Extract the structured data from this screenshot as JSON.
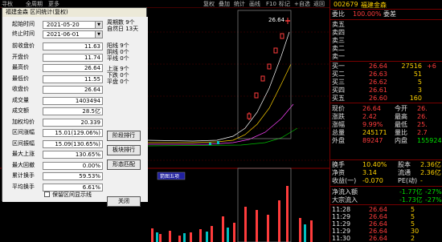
{
  "toolbar": {
    "items": [
      "寻秋",
      "全周期",
      "更多"
    ],
    "right_items": [
      "复权",
      "叠加",
      "统计",
      "画线",
      "F10",
      "标记",
      "+自选",
      "返回"
    ]
  },
  "chart": {
    "price_label": "26.64"
  },
  "dialog": {
    "title": "福建金森 区间统计(复权)",
    "start_label": "起始时间",
    "start_value": "2021-05-20",
    "end_label": "终止时间",
    "end_value": "2021-06-01",
    "cycle_info": "周期数 9个\n自然日 13天",
    "rows": [
      {
        "label": "前收盘价",
        "value": "11.63"
      },
      {
        "label": "开盘价",
        "value": "11.74"
      },
      {
        "label": "最高价",
        "value": "26.64"
      },
      {
        "label": "最低价",
        "value": "11.55"
      },
      {
        "label": "收盘价",
        "value": "26.64"
      },
      {
        "label": "成交量",
        "value": "1403494"
      },
      {
        "label": "成交额",
        "value": "28.5亿"
      },
      {
        "label": "加权均价",
        "value": "20.339"
      },
      {
        "label": "区间涨幅",
        "value": "15.01(129.06%)"
      },
      {
        "label": "区间振幅",
        "value": "15.09(130.65%)"
      },
      {
        "label": "最大上涨",
        "value": "130.65%"
      },
      {
        "label": "最大回撤",
        "value": "0.00%"
      },
      {
        "label": "累计换手",
        "value": "59.53%"
      },
      {
        "label": "平均换手",
        "value": "6.61%"
      }
    ],
    "limit_stats": "阳线 9个\n阴线 0个\n平线 0个",
    "updown_stats": "上涨 9个\n下跌 0个\n平盘 0个",
    "buttons": [
      "阶段排行",
      "板块排行",
      "形态匹配",
      "关闭"
    ],
    "checkbox_label": "保留区间显示线"
  },
  "quote": {
    "code": "002679",
    "name": "福建金森",
    "weibi_label": "委比",
    "weibi_value": "100.00%",
    "weicha_label": "委差",
    "sells": [
      {
        "label": "卖五",
        "price": "",
        "vol": ""
      },
      {
        "label": "卖四",
        "price": "",
        "vol": ""
      },
      {
        "label": "卖三",
        "price": "",
        "vol": ""
      },
      {
        "label": "卖二",
        "price": "",
        "vol": ""
      },
      {
        "label": "卖一",
        "price": "",
        "vol": ""
      }
    ],
    "buys": [
      {
        "label": "买一",
        "price": "26.64",
        "vol": "27516",
        "ext": "+6"
      },
      {
        "label": "买二",
        "price": "26.63",
        "vol": "51",
        "ext": ""
      },
      {
        "label": "买三",
        "price": "26.62",
        "vol": "5",
        "ext": ""
      },
      {
        "label": "买四",
        "price": "26.61",
        "vol": "3",
        "ext": ""
      },
      {
        "label": "买五",
        "price": "26.60",
        "vol": "160",
        "ext": ""
      }
    ],
    "stats": [
      {
        "l1": "现价",
        "v1": "26.64",
        "l2": "今开",
        "v2": "26."
      },
      {
        "l1": "涨跌",
        "v1": "2.42",
        "l2": "最高",
        "v2": "26."
      },
      {
        "l1": "涨幅",
        "v1": "9.99%",
        "l2": "最低",
        "v2": "25."
      },
      {
        "l1": "总量",
        "v1": "245171",
        "l2": "量比",
        "v2": "2.7"
      },
      {
        "l1": "外盘",
        "v1": "89247",
        "l2": "内盘",
        "v2": "155924"
      }
    ],
    "stats2": [
      {
        "l1": "换手",
        "v1": "10.40%",
        "l2": "股本",
        "v2": "2.36亿"
      },
      {
        "l1": "净资",
        "v1": "3.14",
        "l2": "流通",
        "v2": "2.36亿"
      },
      {
        "l1": "收益(一)",
        "v1": "-0.070",
        "l2": "PE(动)",
        "v2": "-"
      }
    ],
    "flows": [
      {
        "label": "净流入额",
        "value": "-1.77亿",
        "pct": "-27%"
      },
      {
        "label": "大宗流入",
        "value": "-1.73亿",
        "pct": "-27%"
      }
    ],
    "ticks": [
      {
        "time": "11:28",
        "price": "26.64",
        "vol": "5"
      },
      {
        "time": "11:29",
        "price": "26.64",
        "vol": "5"
      },
      {
        "time": "11:29",
        "price": "26.64",
        "vol": "5"
      },
      {
        "time": "11:29",
        "price": "26.64",
        "vol": "30"
      },
      {
        "time": "11:30",
        "price": "26.64",
        "vol": "2"
      }
    ]
  }
}
